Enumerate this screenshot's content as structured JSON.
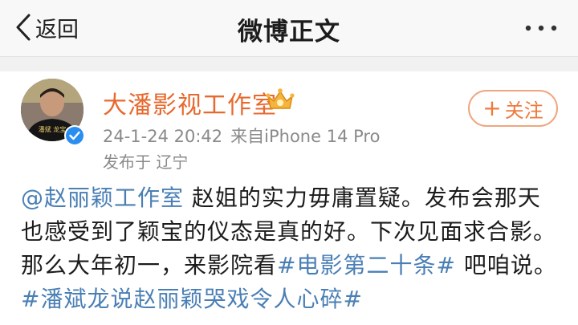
{
  "nav": {
    "back_label": "返回",
    "title": "微博正文"
  },
  "post": {
    "author": "大潘影视工作室",
    "timestamp": "24-1-24 20:42",
    "source": "来自iPhone 14 Pro",
    "location": "发布于 辽宁",
    "follow_label": "关注",
    "follow_plus": "+",
    "avatar_text": "潘斌 龙宝",
    "body": {
      "mention": "@赵丽颖工作室",
      "text1": " 赵姐的实力毋庸置疑。发布会那天也感受到了颖宝的仪态是真的好。下次见面求合影。那么大年初一，来影院看",
      "hashtag1": "#电影第二十条#",
      "text2": " 吧咱说。",
      "hashtag2": "#潘斌龙说赵丽颖哭戏令人心碎#"
    }
  },
  "colors": {
    "username": "#e8692f",
    "link": "#4a7fb5",
    "follow": "#ee7a3c",
    "verify": "#2a8ef0"
  },
  "icons": {
    "back": "chevron-left-icon",
    "more": "more-dots-icon",
    "verify": "verified-badge-icon",
    "crown": "vip-crown-icon"
  }
}
